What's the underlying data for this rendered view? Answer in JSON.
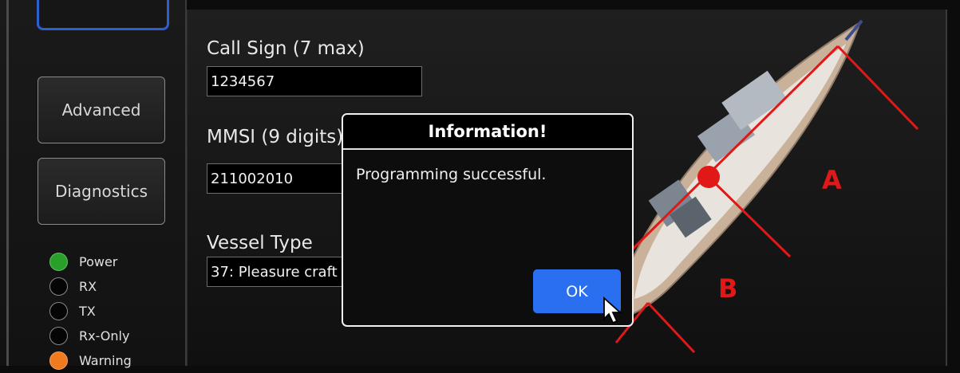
{
  "sidebar": {
    "buttons": [
      {
        "label": "Advanced"
      },
      {
        "label": "Diagnostics"
      }
    ],
    "indicators": [
      {
        "label": "Power",
        "color": "#2aa02a"
      },
      {
        "label": "RX",
        "color": "#050505"
      },
      {
        "label": "TX",
        "color": "#050505"
      },
      {
        "label": "Rx-Only",
        "color": "#050505"
      },
      {
        "label": "Warning",
        "color": "#f07a1e"
      }
    ]
  },
  "form": {
    "call_sign": {
      "label": "Call Sign (7 max)",
      "value": "1234567"
    },
    "mmsi": {
      "label": "MMSI (9 digits)",
      "value": "211002010"
    },
    "vessel_type": {
      "label": "Vessel Type",
      "value": "37: Pleasure craft"
    }
  },
  "diagram": {
    "label_a": "A",
    "label_b": "B",
    "marker_color": "#e01818"
  },
  "dialog": {
    "title": "Information!",
    "message": "Programming successful.",
    "ok_label": "OK",
    "ok_color": "#2a6ff0"
  }
}
